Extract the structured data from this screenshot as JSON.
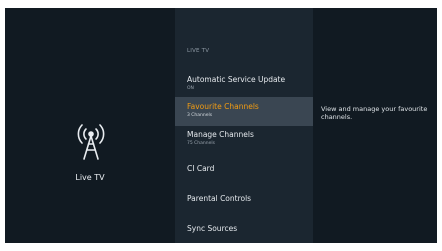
{
  "left": {
    "title": "Live TV",
    "icon": "antenna-icon"
  },
  "menu": {
    "header": "LIVE TV",
    "items": [
      {
        "label": "Automatic Service Update",
        "sub": "ON",
        "selected": false
      },
      {
        "label": "Favourite Channels",
        "sub": "3 Channels",
        "selected": true
      },
      {
        "label": "Manage Channels",
        "sub": "75 Channels",
        "selected": false
      },
      {
        "label": "CI Card",
        "sub": "",
        "selected": false
      },
      {
        "label": "Parental Controls",
        "sub": "",
        "selected": false
      },
      {
        "label": "Sync Sources",
        "sub": "",
        "selected": false
      }
    ]
  },
  "detail": {
    "description": "View and manage your favourite channels."
  },
  "colors": {
    "accent": "#f39c12",
    "left_bg": "#111a22",
    "menu_bg": "#1b2630",
    "selected_bg": "#3a4652"
  }
}
